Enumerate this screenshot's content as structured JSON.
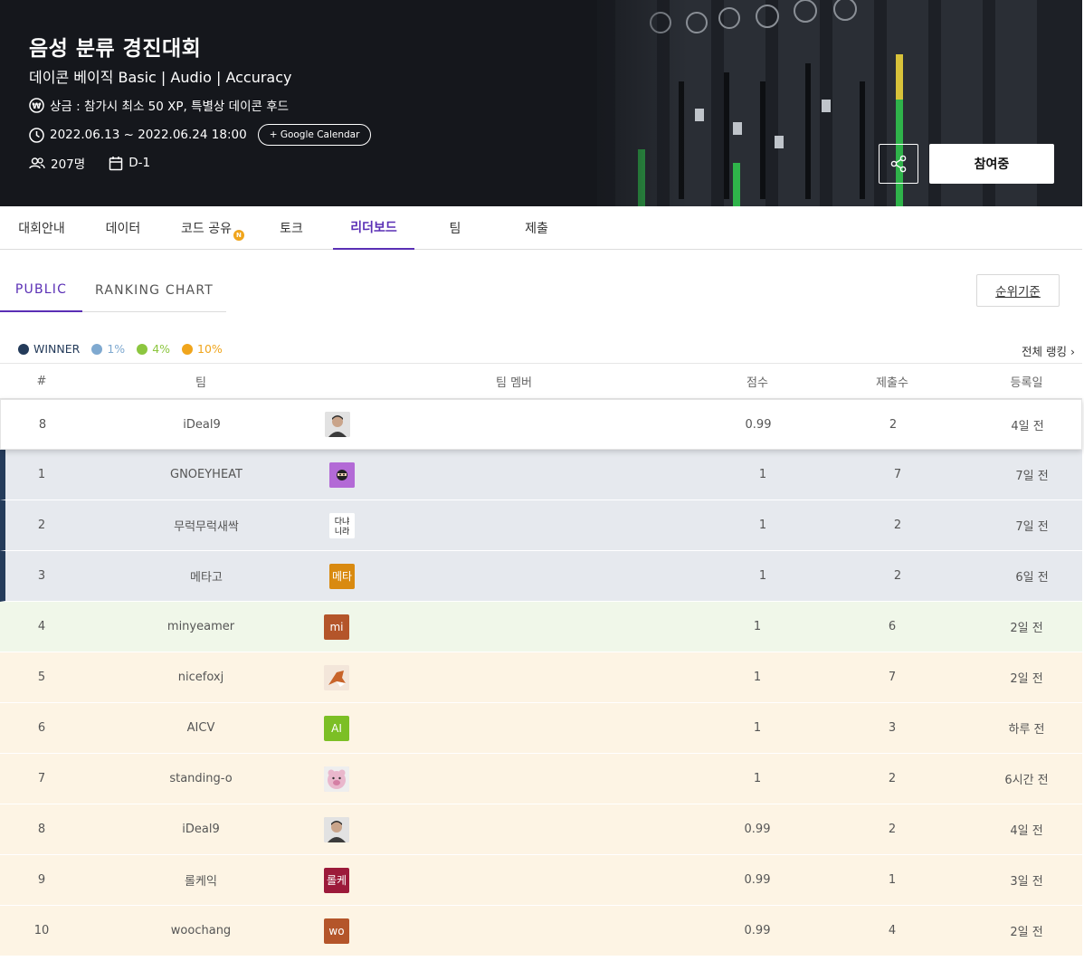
{
  "header": {
    "title": "음성 분류 경진대회",
    "subtitle": "데이콘 베이직 Basic | Audio | Accuracy",
    "prize": "상금 : 참가시 최소 50 XP, 특별상 데이콘 후드",
    "period": "2022.06.13 ~ 2022.06.24 18:00",
    "google_calendar": "+ Google Calendar",
    "participants": "207명",
    "dday": "D-1",
    "join_label": "참여중"
  },
  "nav": {
    "tabs": [
      {
        "label": "대회안내"
      },
      {
        "label": "데이터"
      },
      {
        "label": "코드 공유",
        "badge": "N"
      },
      {
        "label": "토크"
      },
      {
        "label": "리더보드",
        "active": true
      },
      {
        "label": "팀"
      },
      {
        "label": "제출"
      }
    ]
  },
  "subtabs": {
    "public": "PUBLIC",
    "ranking_chart": "RANKING CHART",
    "rank_criteria": "순위기준"
  },
  "legend": {
    "items": [
      {
        "label": "WINNER",
        "color": "#243b5a"
      },
      {
        "label": "1%",
        "color": "#7fa9d0"
      },
      {
        "label": "4%",
        "color": "#8cc63f"
      },
      {
        "label": "10%",
        "color": "#f0a51c"
      }
    ],
    "full_ranking": "전체 랭킹 ›"
  },
  "table": {
    "headers": {
      "rank": "#",
      "team": "팀",
      "members": "팀 멤버",
      "score": "점수",
      "submissions": "제출수",
      "date": "등록일"
    },
    "my_row": {
      "rank": "8",
      "team": "iDeal9",
      "avatar_text": "",
      "score": "0.99",
      "submissions": "2",
      "date": "4일 전"
    },
    "rows": [
      {
        "rank": "1",
        "team": "GNOEYHEAT",
        "avatar_text": "",
        "avatar_color": "#b36ad6",
        "score": "1",
        "submissions": "7",
        "date": "7일 전",
        "tier": "winner"
      },
      {
        "rank": "2",
        "team": "무럭무럭새싹",
        "avatar_text": "",
        "avatar_color": "#ffffff",
        "score": "1",
        "submissions": "2",
        "date": "7일 전",
        "tier": "winner"
      },
      {
        "rank": "3",
        "team": "메타고",
        "avatar_text": "메타",
        "avatar_color": "#d98a10",
        "score": "1",
        "submissions": "2",
        "date": "6일 전",
        "tier": "winner"
      },
      {
        "rank": "4",
        "team": "minyeamer",
        "avatar_text": "mi",
        "avatar_color": "#b4552a",
        "score": "1",
        "submissions": "6",
        "date": "2일 전",
        "tier": "p4"
      },
      {
        "rank": "5",
        "team": "nicefoxj",
        "avatar_text": "",
        "avatar_color": "#f3e6da",
        "score": "1",
        "submissions": "7",
        "date": "2일 전",
        "tier": "p10"
      },
      {
        "rank": "6",
        "team": "AICV",
        "avatar_text": "AI",
        "avatar_color": "#7cbf25",
        "score": "1",
        "submissions": "3",
        "date": "하루 전",
        "tier": "p10"
      },
      {
        "rank": "7",
        "team": "standing-o",
        "avatar_text": "",
        "avatar_color": "#e9c6d6",
        "score": "1",
        "submissions": "2",
        "date": "6시간 전",
        "tier": "p10"
      },
      {
        "rank": "8",
        "team": "iDeal9",
        "avatar_text": "",
        "avatar_color": "#cfcfcf",
        "score": "0.99",
        "submissions": "2",
        "date": "4일 전",
        "tier": "p10"
      },
      {
        "rank": "9",
        "team": "롤케익",
        "avatar_text": "롤케",
        "avatar_color": "#9c1a3a",
        "score": "0.99",
        "submissions": "1",
        "date": "3일 전",
        "tier": "p10"
      },
      {
        "rank": "10",
        "team": "woochang",
        "avatar_text": "wo",
        "avatar_color": "#b4552a",
        "score": "0.99",
        "submissions": "4",
        "date": "2일 전",
        "tier": "p10"
      }
    ]
  }
}
